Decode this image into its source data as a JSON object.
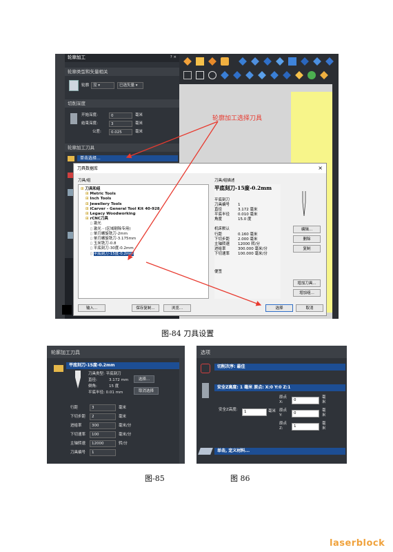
{
  "fig84": {
    "panel_title": "轮廓加工",
    "panel_controls": "? ×",
    "section_contour": "轮廓类型和矢量相关",
    "contour_label": "轮廓",
    "contour_option1": "没",
    "contour_option2": "已选矢量",
    "section_depth": "切削深度",
    "start_depth_label": "开始深度:",
    "start_depth_value": "0",
    "end_depth_label": "结束深度:",
    "end_depth_value": "3",
    "tolerance_label": "公差:",
    "tolerance_value": "0.025",
    "unit_mm": "毫米",
    "section_tool": "轮廓加工刀具",
    "tool_select_bar": "单击选择...",
    "annotation": "轮廓加工选择刀具",
    "dialog_title": "刀具数据库",
    "dialog_close": "×",
    "tree_header": "刀具/组",
    "tree": [
      {
        "label": "刀具和组",
        "indent": 0,
        "bold": true
      },
      {
        "label": "Metric Tools",
        "indent": 1,
        "bold": true
      },
      {
        "label": "Inch Tools",
        "indent": 1,
        "bold": true
      },
      {
        "label": "Jewellery Tools",
        "indent": 1,
        "bold": true
      },
      {
        "label": "iCarver - General Tool Kit 40-928",
        "indent": 1,
        "bold": true
      },
      {
        "label": "Legacy Woodworking",
        "indent": 1,
        "bold": true
      },
      {
        "label": "rCNC刀具",
        "indent": 1,
        "bold": true
      },
      {
        "label": "激光",
        "indent": 2,
        "bold": false
      },
      {
        "label": "激光 - (区域剔除专用)",
        "indent": 2,
        "bold": false
      },
      {
        "label": "单刃螺旋铣刀-2mm",
        "indent": 2,
        "bold": false
      },
      {
        "label": "单刃螺旋铣刀-3.175mm",
        "indent": 2,
        "bold": false
      },
      {
        "label": "玉米铣刀-0.8",
        "indent": 2,
        "bold": false
      },
      {
        "label": "平底刻刀-30度-0.2mm",
        "indent": 2,
        "bold": false
      },
      {
        "label": "平底刻刀-15度-0.2mm",
        "indent": 2,
        "bold": false,
        "selected": true
      }
    ],
    "details_header": "刀具/组描述",
    "tool_name": "平底刻刀-15度-0.2mm",
    "details": [
      {
        "k": "平底刻刀",
        "v": ""
      },
      {
        "k": "刀具编号",
        "v": "1"
      },
      {
        "k": "直径",
        "v": "3.172  毫米"
      },
      {
        "k": "平底半径",
        "v": "0.010  毫米"
      },
      {
        "k": "角度",
        "v": "15.0  度"
      }
    ],
    "machine_header": "机床默认",
    "machine": [
      {
        "k": "行距",
        "v": "0.160  毫米"
      },
      {
        "k": "下切步距",
        "v": "2.000  毫米"
      },
      {
        "k": "主轴转速",
        "v": "12000  转/分"
      },
      {
        "k": "进给率",
        "v": "300.000  毫米/分"
      },
      {
        "k": "下切速率",
        "v": "100.000  毫米/分"
      }
    ],
    "notes_label": "便签",
    "btn_edit": "编辑...",
    "btn_delete": "删除",
    "btn_copy": "复制",
    "btn_add_tool": "增加刀具...",
    "btn_add_group": "增加组...",
    "btn_import": "输入...",
    "btn_save_copy": "保存复制...",
    "btn_browse": "浏览...",
    "btn_select": "选择",
    "btn_cancel": "取消",
    "caption": "图-84  刀具设置"
  },
  "fig85": {
    "panel_title": "轮廓加工刀具",
    "tool_bar": "平底刻刀-15度-0.2mm",
    "tool_type": "刀具类型: 平底刻刀",
    "diameter_label": "直径:",
    "diameter_value": "3.172 mm",
    "angle_label": "倒角:",
    "angle_value": "15 度",
    "flat_radius": "平底半径: 0.01 mm",
    "btn_select": "选择...",
    "btn_deselect": "取消选择",
    "params": [
      {
        "k": "行距",
        "v": "3",
        "u": "毫米"
      },
      {
        "k": "下切步距",
        "v": "2",
        "u": "毫米"
      },
      {
        "k": "进给率",
        "v": "300",
        "u": "毫米/分"
      },
      {
        "k": "下切速率",
        "v": "100",
        "u": "毫米/分"
      },
      {
        "k": "主轴转速",
        "v": "12000",
        "u": "转/分"
      },
      {
        "k": "刀具编号",
        "v": "1",
        "u": ""
      }
    ],
    "caption": "图-85"
  },
  "fig86": {
    "panel_title": "选项",
    "order_bar": "切削次序: 最佳",
    "safe_bar": "安全Z高度: 1 毫米  原点: X:0 Y:0 Z:1",
    "safe_z_label": "安全Z高度:",
    "safe_z_value": "1",
    "origin_x_label": "原点X:",
    "origin_x_value": "0",
    "origin_y_label": "原点Y:",
    "origin_y_value": "0",
    "origin_z_label": "原点Z:",
    "origin_z_value": "1",
    "unit_mm": "毫米",
    "material_bar": "单击, 定义材料...",
    "caption": "图 86"
  },
  "watermark": "laserblock",
  "colors": {
    "dark_panel": "#2f3339",
    "blue_bar": "#1d4e94",
    "annotation_red": "#e83a2f",
    "canvas_yellow": "#f7f58a",
    "watermark_orange": "#f0a23c"
  }
}
